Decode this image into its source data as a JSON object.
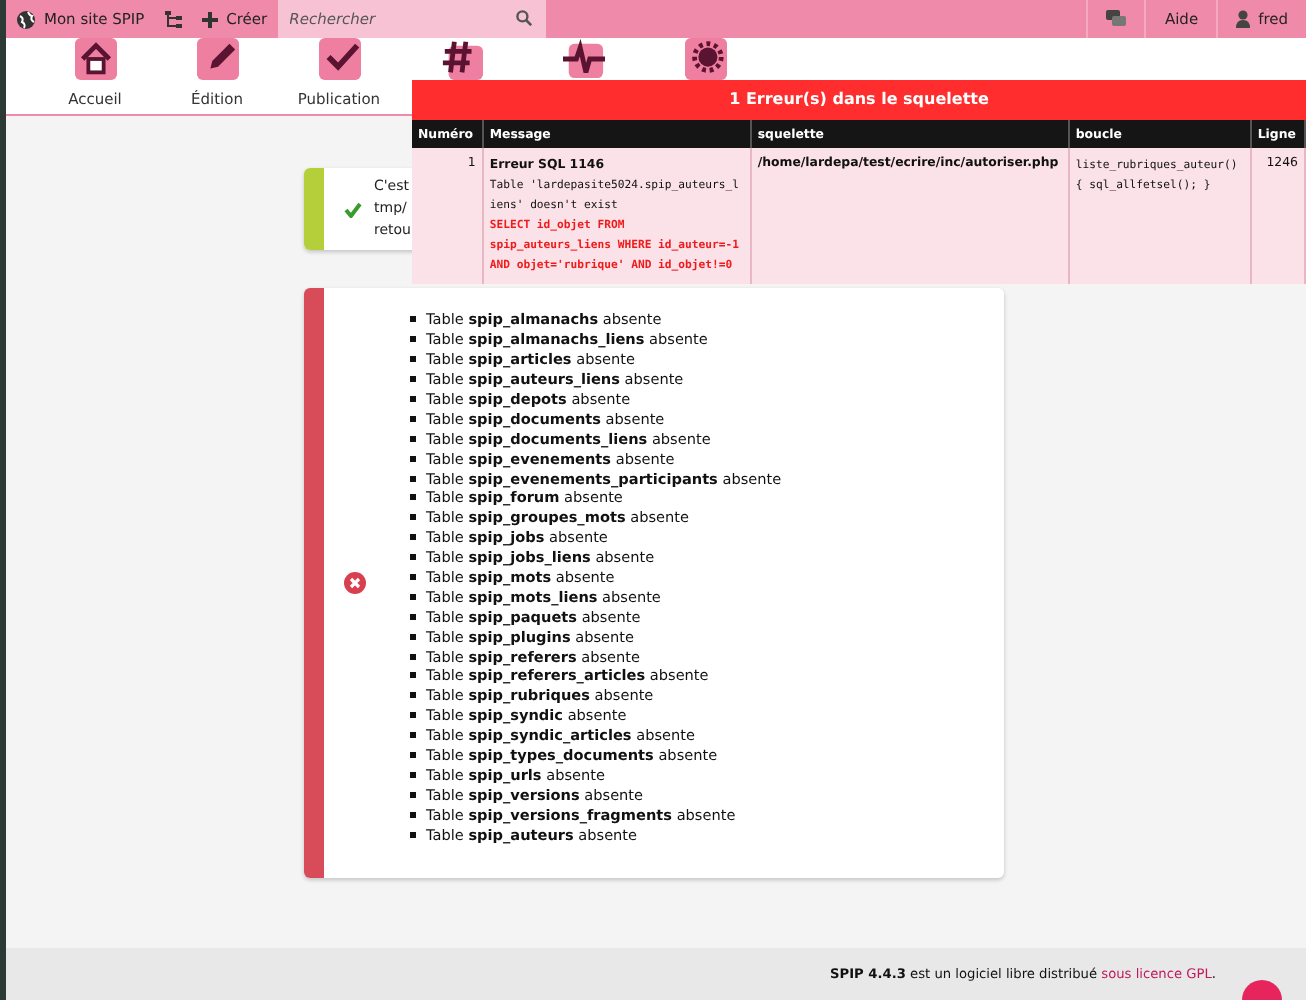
{
  "toolbar": {
    "site": "Mon site SPIP",
    "create": "Créer",
    "search": {
      "placeholder": "Rechercher"
    },
    "help": "Aide",
    "user": "fred"
  },
  "nav": [
    {
      "kind": "labeled",
      "label": "Accueil"
    },
    {
      "kind": "labeled",
      "label": "Édition"
    },
    {
      "kind": "labeled",
      "label": "Publication"
    },
    {
      "kind": "icon_only"
    },
    {
      "kind": "icon_only"
    },
    {
      "kind": "icon_only"
    }
  ],
  "success_message": {
    "lines": [
      "C'est",
      "tmp/",
      "retou"
    ]
  },
  "error_box": {
    "items": [
      "Table **spip_almanachs** absente",
      "Table **spip_almanachs_liens** absente",
      "Table **spip_articles** absente",
      "Table **spip_auteurs_liens** absente",
      "Table **spip_depots** absente",
      "Table **spip_documents** absente",
      "Table **spip_documents_liens** absente",
      "Table **spip_evenements** absente",
      "Table **spip_evenements_participants** absente",
      "Table **spip_forum** absente",
      "Table **spip_groupes_mots** absente",
      "Table **spip_jobs** absente",
      "Table **spip_jobs_liens** absente",
      "Table **spip_mots** absente",
      "Table **spip_mots_liens** absente",
      "Table **spip_paquets** absente",
      "Table **spip_plugins** absente",
      "Table **spip_referers** absente",
      "Table **spip_referers_articles** absente",
      "Table **spip_rubriques** absente",
      "Table **spip_syndic** absente",
      "Table **spip_syndic_articles** absente",
      "Table **spip_types_documents** absente",
      "Table **spip_urls** absente",
      "Table **spip_versions** absente",
      "Table **spip_versions_fragments** absente",
      "Table **spip_auteurs** absente"
    ]
  },
  "debug_panel": {
    "title": "1 Erreur(s) dans le squelette",
    "columns": [
      "Numéro",
      "Message",
      "squelette",
      "boucle",
      "Ligne"
    ],
    "rows": [
      {
        "number": "1",
        "error_title": "Erreur SQL 1146",
        "error_text": "Table 'lardepasite5024.spip_auteurs_liens' doesn't exist",
        "query": "SELECT id_objet FROM spip_auteurs_liens WHERE id_auteur=-1 AND objet='rubrique' AND id_objet!=0",
        "file": "/home/lardepa/test/ecrire/inc/autoriser.php",
        "loop": "liste_rubriques_auteur() { sql_allfetsel(); }",
        "line": "1246"
      }
    ]
  },
  "footer": {
    "version": "SPIP 4.4.3",
    "text": " est un logiciel libre distribué ",
    "link": "sous licence GPL",
    "end": "."
  }
}
